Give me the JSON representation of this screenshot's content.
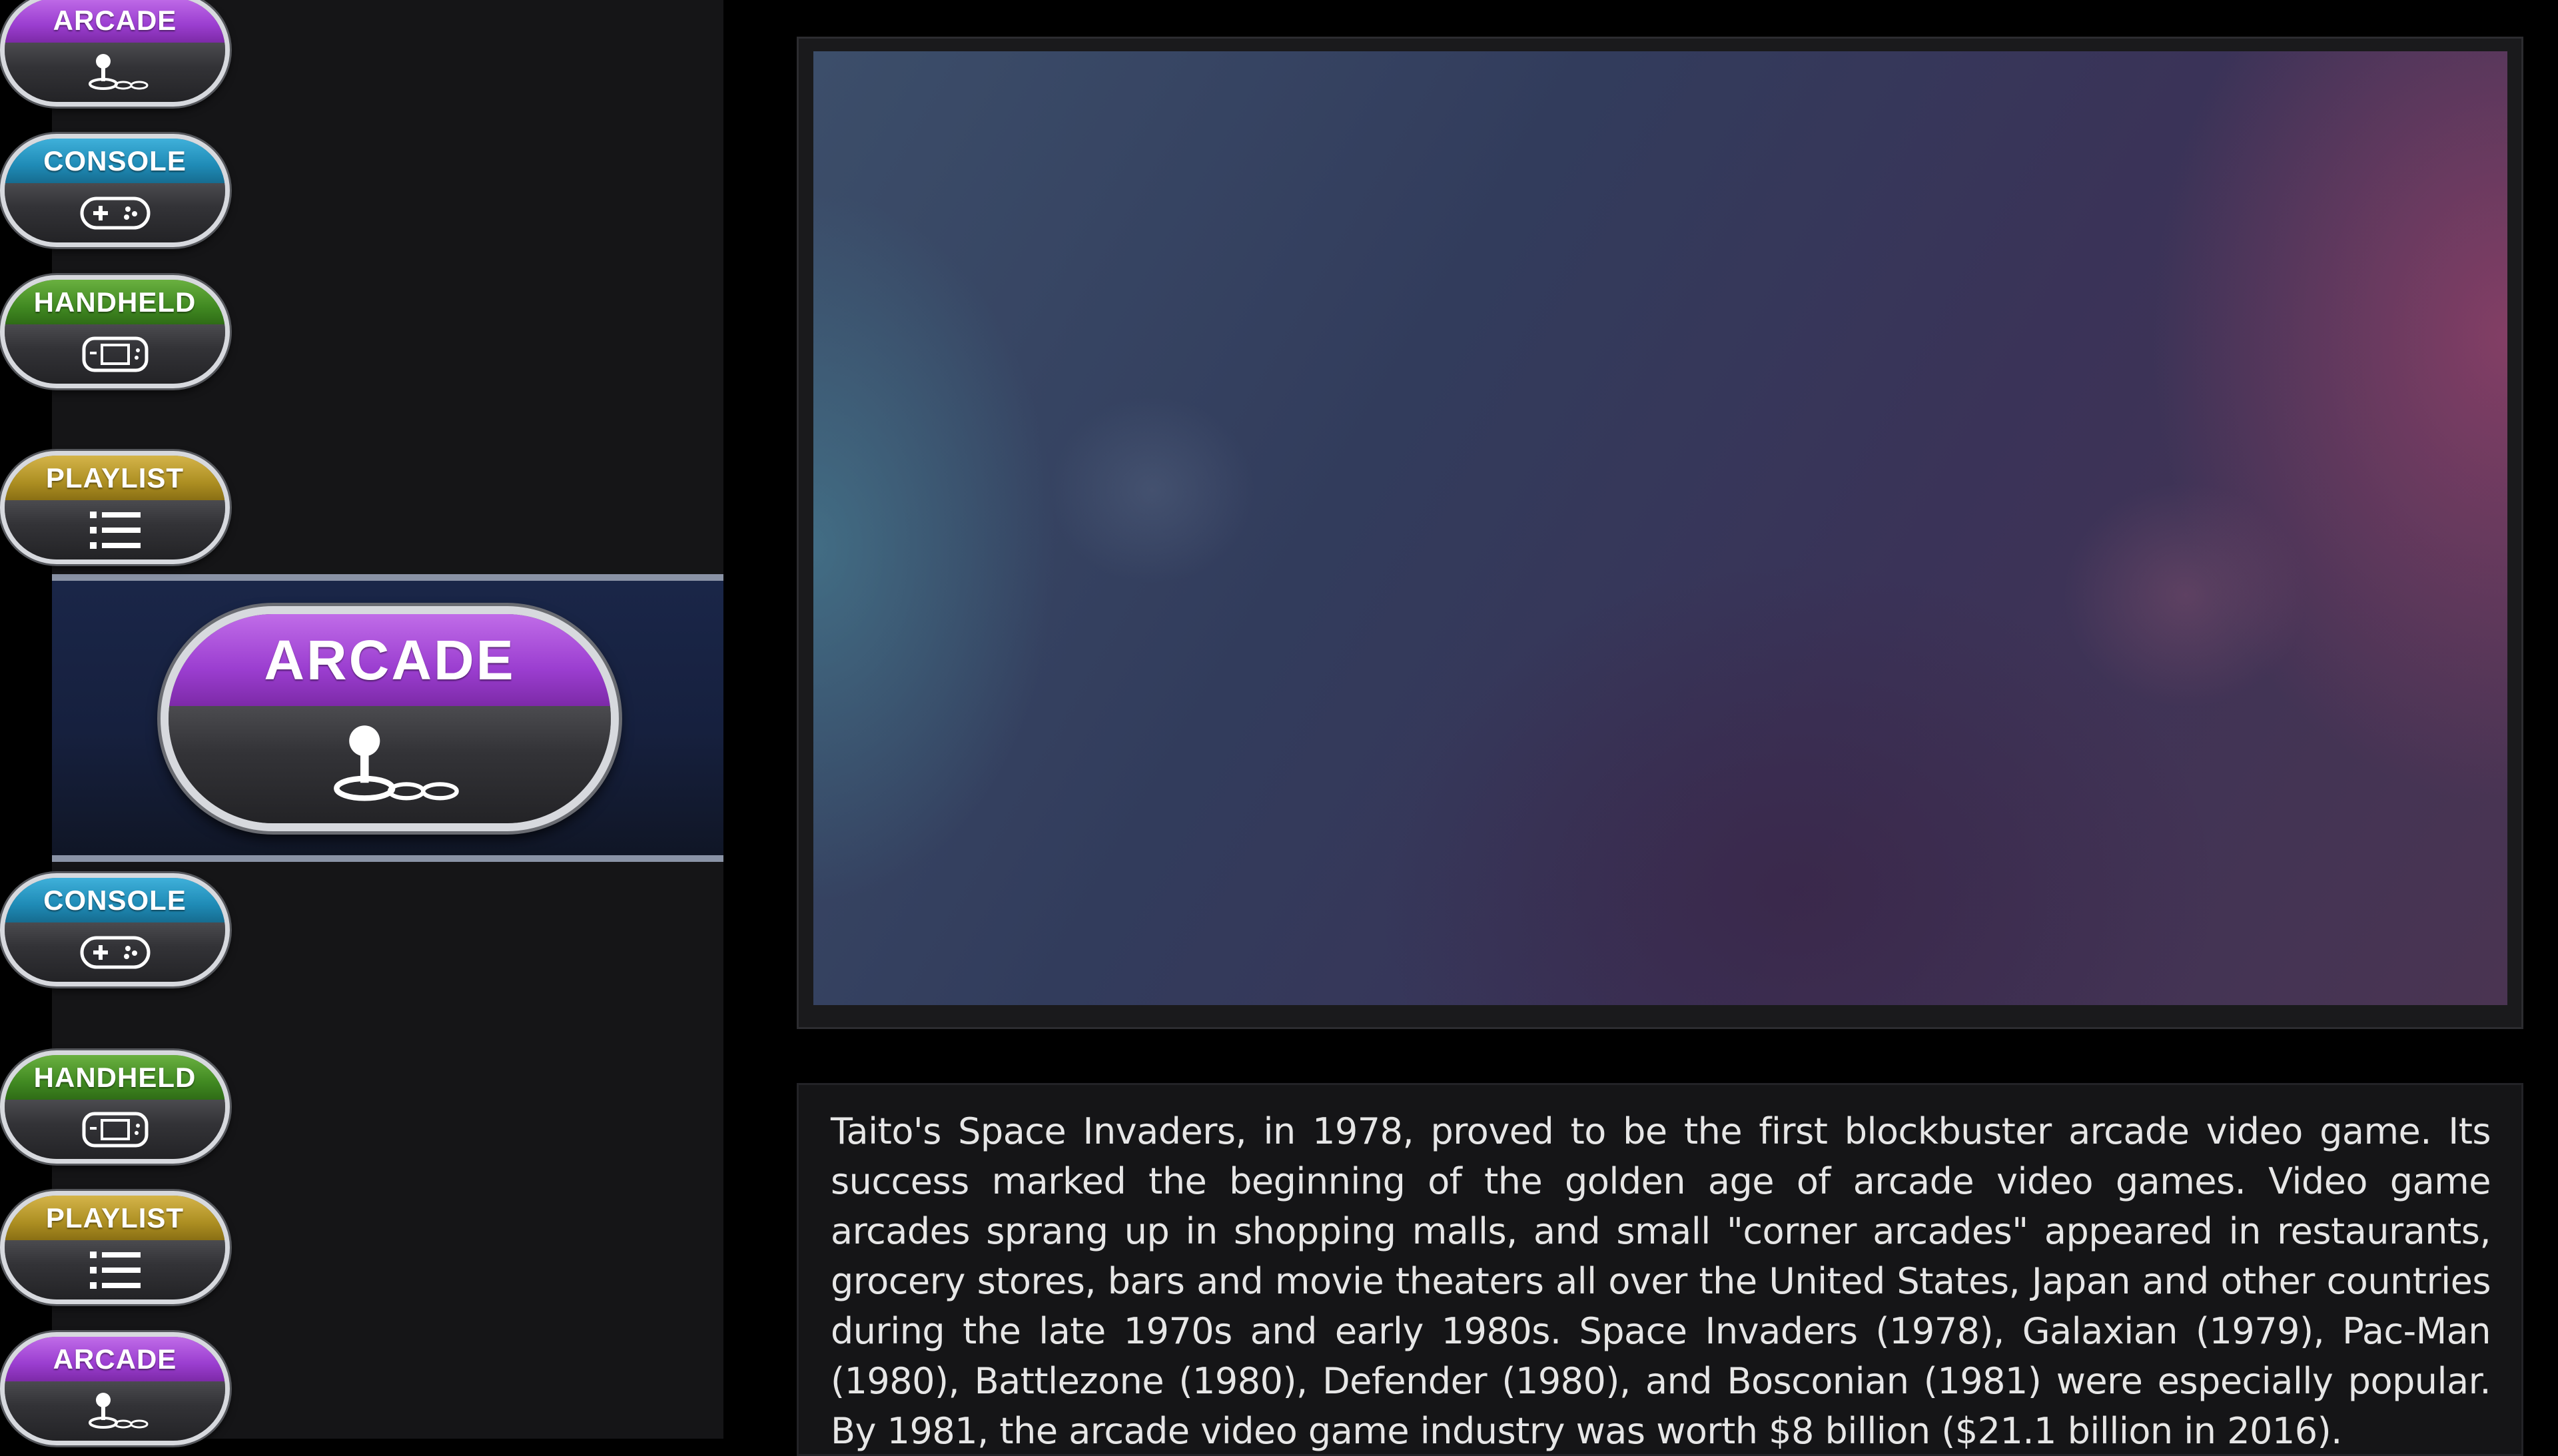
{
  "wheel": {
    "items": [
      {
        "label": "ARCADE",
        "icon": "joystick-icon"
      },
      {
        "label": "CONSOLE",
        "icon": "gamepad-icon"
      },
      {
        "label": "HANDHELD",
        "icon": "handheld-icon"
      },
      {
        "label": "PLAYLIST",
        "icon": "list-icon"
      },
      {
        "label": "ARCADE",
        "icon": "joystick-icon",
        "selected": true
      },
      {
        "label": "CONSOLE",
        "icon": "gamepad-icon"
      },
      {
        "label": "HANDHELD",
        "icon": "handheld-icon"
      },
      {
        "label": "PLAYLIST",
        "icon": "list-icon"
      },
      {
        "label": "ARCADE",
        "icon": "joystick-icon"
      }
    ]
  },
  "video": {
    "colors": {
      "teal": "#4a8c9e",
      "magenta": "#8e4068",
      "navy": "#323c5c"
    }
  },
  "description": {
    "text": "Taito's Space Invaders, in 1978, proved to be the first blockbuster arcade video game. Its success marked the beginning of the golden age of arcade video games. Video game arcades sprang up in shopping malls, and small \"corner arcades\" appeared in restaurants, grocery stores, bars and movie theaters all over the United States, Japan and other countries during the late 1970s and early 1980s. Space Invaders (1978), Galaxian (1979), Pac-Man (1980), Battlezone (1980), Defender (1980), and Bosconian (1981) were especially popular. By 1981, the arcade video game industry was worth $8 billion ($21.1 billion in 2016)."
  },
  "colors": {
    "arcade": "#9b3ed0",
    "console": "#1f8bb6",
    "handheld": "#418a22",
    "playlist": "#ad8f22",
    "selection_band": "#16203e"
  }
}
